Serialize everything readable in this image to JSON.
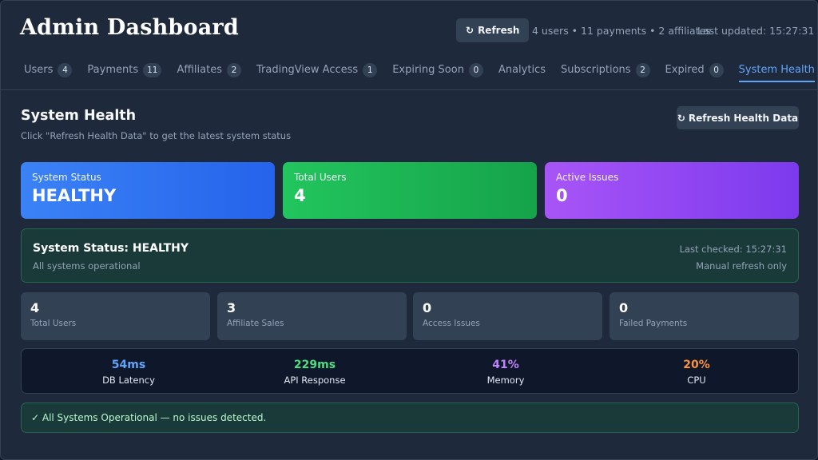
{
  "app": {
    "title": "Admin Dashboard",
    "refresh_label": "Refresh",
    "summary": "4 users • 11 payments • 2 affiliates",
    "last_updated": "Last updated: 15:27:31"
  },
  "tabs": [
    {
      "label": "Users",
      "count": "4"
    },
    {
      "label": "Payments",
      "count": "11"
    },
    {
      "label": "Affiliates",
      "count": "2"
    },
    {
      "label": "TradingView Access",
      "count": "1"
    },
    {
      "label": "Expiring Soon",
      "count": "0"
    },
    {
      "label": "Analytics",
      "count": ""
    },
    {
      "label": "Subscriptions",
      "count": "2"
    },
    {
      "label": "Expired",
      "count": "0"
    },
    {
      "label": "System Health",
      "count": ""
    }
  ],
  "active_tab": "System Health",
  "health": {
    "title": "System Health",
    "subtitle": "Click \"Refresh Health Data\" to get the latest system status",
    "refresh_label": "Refresh Health Data",
    "cards": [
      {
        "label": "System Status",
        "value": "HEALTHY",
        "color": "#2563eb"
      },
      {
        "label": "Total Users",
        "value": "4",
        "color": "#16a34a"
      },
      {
        "label": "Active Issues",
        "value": "0",
        "color": "#7c3aed"
      }
    ],
    "status_panel": {
      "title": "System Status: HEALTHY",
      "subtitle": "All systems operational",
      "last_checked": "Last checked: 15:27:31",
      "manual": "Manual refresh only"
    },
    "metrics": [
      {
        "value": "4",
        "label": "Total Users"
      },
      {
        "value": "3",
        "label": "Affiliate Sales"
      },
      {
        "value": "0",
        "label": "Access Issues"
      },
      {
        "value": "0",
        "label": "Failed Payments"
      }
    ],
    "performance": [
      {
        "value": "54ms",
        "label": "DB Latency",
        "color": "#60a5fa"
      },
      {
        "value": "229ms",
        "label": "API Response",
        "color": "#4ade80"
      },
      {
        "value": "41%",
        "label": "Memory",
        "color": "#c084fc"
      },
      {
        "value": "20%",
        "label": "CPU",
        "color": "#fb923c"
      }
    ],
    "ops_message": "✓ All Systems Operational — no issues detected."
  }
}
